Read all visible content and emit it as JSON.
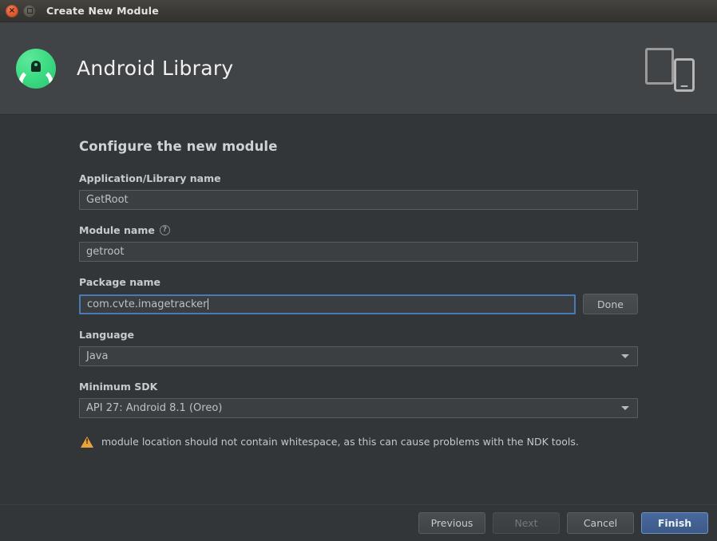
{
  "window": {
    "title": "Create New Module",
    "close_label": "×",
    "maximize_label": "",
    "close_icon": "close-icon",
    "maximize_icon": "maximize-icon"
  },
  "header": {
    "title": "Android Library",
    "logo_icon": "android-studio-logo-icon",
    "device_icon": "tablet-and-phone-icon"
  },
  "main": {
    "section_title": "Configure the new module",
    "fields": [
      {
        "label": "Application/Library name",
        "value": "GetRoot",
        "type": "text",
        "focused": false,
        "has_help": false
      },
      {
        "label": "Module name",
        "value": "getroot",
        "type": "text",
        "focused": false,
        "has_help": true,
        "help_icon": "help-circle-icon",
        "help_glyph": "?"
      },
      {
        "label": "Package name",
        "value": "com.cvte.imagetracker",
        "type": "text",
        "focused": true,
        "has_help": false,
        "side_button": "Done"
      },
      {
        "label": "Language",
        "value": "Java",
        "type": "select",
        "focused": false,
        "has_help": false,
        "arrow_icon": "chevron-down-icon"
      },
      {
        "label": "Minimum SDK",
        "value": "API 27: Android 8.1 (Oreo)",
        "type": "select",
        "focused": false,
        "has_help": false,
        "arrow_icon": "chevron-down-icon"
      }
    ],
    "warning": {
      "icon": "warning-triangle-icon",
      "glyph": "!",
      "text": "module location should not contain whitespace, as this can cause problems with the NDK tools."
    }
  },
  "footer": {
    "buttons": [
      {
        "label": "Previous",
        "state": "enabled"
      },
      {
        "label": "Next",
        "state": "disabled"
      },
      {
        "label": "Cancel",
        "state": "enabled"
      },
      {
        "label": "Finish",
        "state": "primary"
      }
    ]
  },
  "colors": {
    "titlebar": "#3b3935",
    "header_band": "#414446",
    "body_background": "#333638",
    "input_background": "#3b3f41",
    "input_border": "#5a5e60",
    "focus_border": "#4a79b8",
    "primary_button": "#3c5a88",
    "warning": "#e8a33d",
    "close_button": "#df5b32",
    "logo_green": "#3ddc84"
  }
}
